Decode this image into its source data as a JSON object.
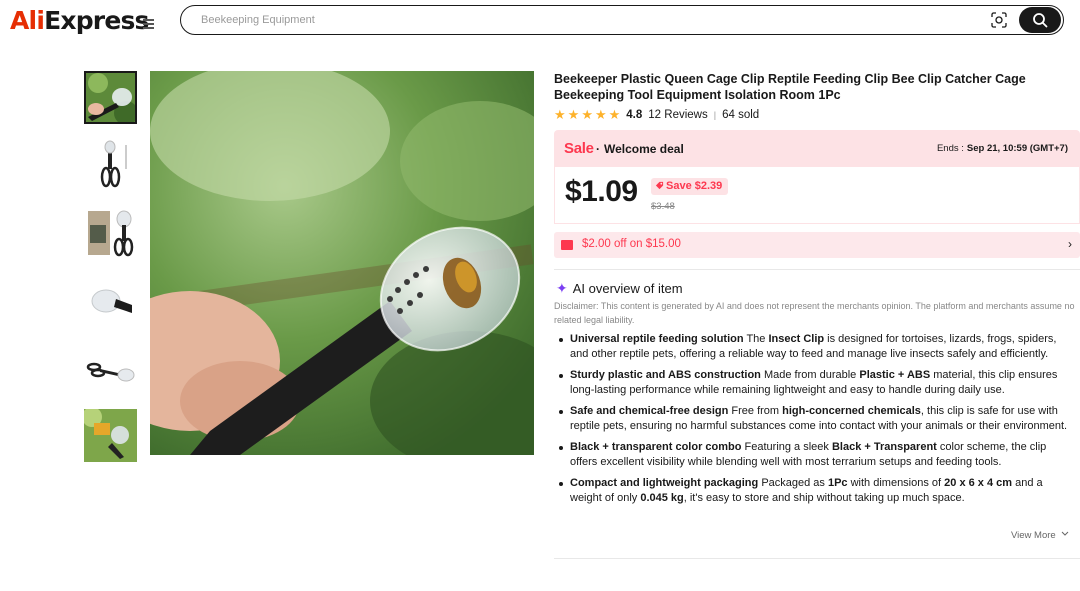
{
  "header": {
    "logo_part1": "Ali",
    "logo_part2": "Express",
    "search_placeholder": "Beekeeping Equipment",
    "search_button_icon": "search-icon",
    "camera_icon": "camera-search-icon",
    "menu_icon": "hamburger-menu-icon"
  },
  "gallery": {
    "thumbnails": [
      {
        "name": "thumbnail-1",
        "active": true
      },
      {
        "name": "thumbnail-2",
        "active": false
      },
      {
        "name": "thumbnail-3",
        "active": false
      },
      {
        "name": "thumbnail-4",
        "active": false
      },
      {
        "name": "thumbnail-5",
        "active": false
      },
      {
        "name": "thumbnail-6",
        "active": false
      }
    ]
  },
  "product": {
    "title": "Beekeeper Plastic Queen Cage Clip Reptile Feeding Clip Bee Clip Catcher Cage Beekeeping Tool Equipment Isolation Room 1Pc",
    "rating": "4.8",
    "reviews": "12 Reviews",
    "separator": "|",
    "sold": "64 sold",
    "star_count": 5,
    "star_color": "#fdb22b"
  },
  "sale": {
    "label": "Sale",
    "dot": "·",
    "deal": "Welcome deal",
    "ends_label": "Ends :",
    "ends_time": "Sep 21, 10:59 (GMT+7)",
    "accent_color": "#fd384f"
  },
  "price": {
    "current": "$1.09",
    "save": "Save $2.39",
    "original": "$3.48"
  },
  "coupon": {
    "text": "$2.00 off on $15.00",
    "chevron": "›"
  },
  "ai_overview": {
    "heading": "AI overview of item",
    "spark": "✦",
    "disclaimer": "Disclaimer: This content is generated by AI and does not represent the merchants opinion. The platform and merchants assume no related legal liability.",
    "items": [
      {
        "title": "Universal reptile feeding solution",
        "body": [
          [
            "The ",
            false
          ],
          [
            "Insect Clip",
            true
          ],
          [
            " is designed for tortoises, lizards, frogs, spiders, and other reptile pets, offering a reliable way to feed and manage live insects safely and efficiently.",
            false
          ]
        ]
      },
      {
        "title": "Sturdy plastic and ABS construction",
        "body": [
          [
            "Made from durable ",
            false
          ],
          [
            "Plastic + ABS",
            true
          ],
          [
            " material, this clip ensures long-lasting performance while remaining lightweight and easy to handle during daily use.",
            false
          ]
        ]
      },
      {
        "title": "Safe and chemical-free design",
        "body": [
          [
            "Free from ",
            false
          ],
          [
            "high-concerned chemicals",
            true
          ],
          [
            ", this clip is safe for use with reptile pets, ensuring no harmful substances come into contact with your animals or their environment.",
            false
          ]
        ]
      },
      {
        "title": "Black + transparent color combo",
        "body": [
          [
            "Featuring a sleek ",
            false
          ],
          [
            "Black + Transparent",
            true
          ],
          [
            " color scheme, the clip offers excellent visibility while blending well with most terrarium setups and feeding tools.",
            false
          ]
        ]
      },
      {
        "title": "Compact and lightweight packaging",
        "body": [
          [
            "Packaged as ",
            false
          ],
          [
            "1Pc",
            true
          ],
          [
            " with dimensions of ",
            false
          ],
          [
            "20 x 6 x 4 cm",
            true
          ],
          [
            " and a weight of only ",
            false
          ],
          [
            "0.045 kg",
            true
          ],
          [
            ", it's easy to store and ship without taking up much space.",
            false
          ]
        ]
      }
    ],
    "view_more": "View More"
  }
}
